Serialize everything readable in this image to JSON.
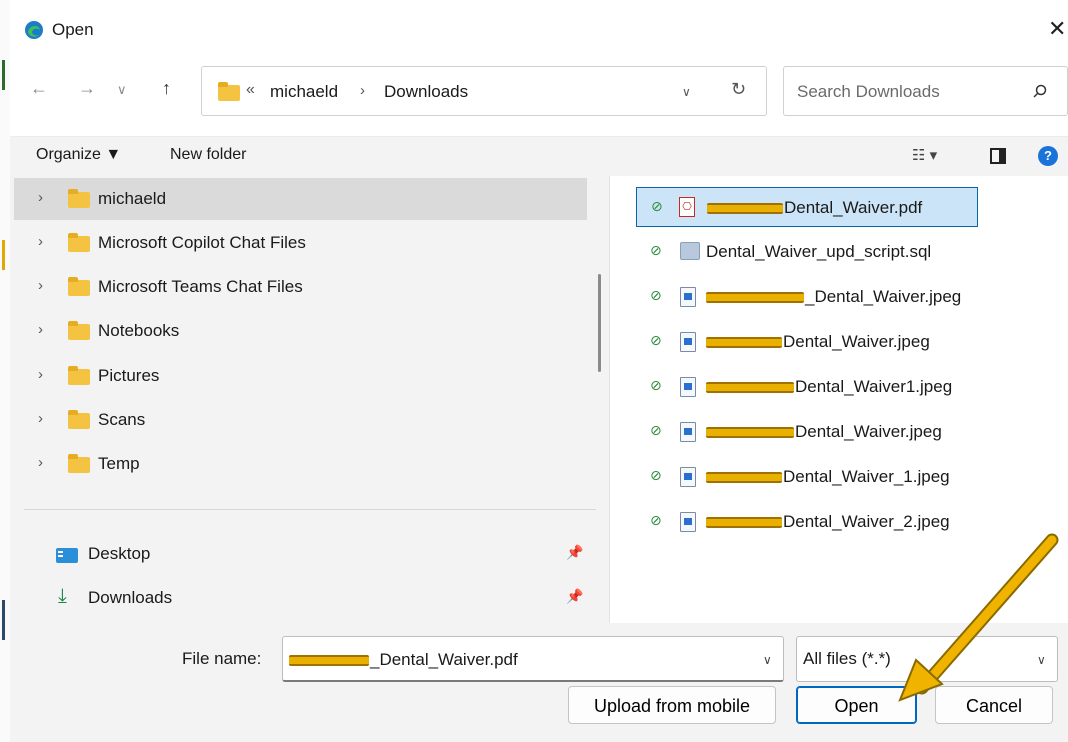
{
  "window": {
    "title": "Open"
  },
  "nav": {
    "breadcrumb_overflow": "«",
    "breadcrumb": [
      "michaeld",
      "Downloads"
    ],
    "search_placeholder": "Search Downloads"
  },
  "toolbar": {
    "organize_label": "Organize ▼",
    "new_folder_label": "New folder"
  },
  "tree": {
    "items": [
      {
        "label": "michaeld",
        "selected": true
      },
      {
        "label": "Microsoft Copilot Chat Files"
      },
      {
        "label": "Microsoft Teams Chat Files"
      },
      {
        "label": "Notebooks"
      },
      {
        "label": "Pictures"
      },
      {
        "label": "Scans"
      },
      {
        "label": "Temp"
      }
    ],
    "quick_access": [
      {
        "label": "Desktop"
      },
      {
        "label": "Downloads"
      }
    ]
  },
  "files": [
    {
      "name": "Dental_Waiver.pdf",
      "type": "pdf",
      "selected": true
    },
    {
      "name": "Dental_Waiver_upd_script.sql",
      "type": "sql"
    },
    {
      "name": "_Dental_Waiver.jpeg",
      "type": "jpeg"
    },
    {
      "name": "Dental_Waiver.jpeg",
      "type": "jpeg"
    },
    {
      "name": "Dental_Waiver1.jpeg",
      "type": "jpeg"
    },
    {
      "name": "Dental_Waiver.jpeg",
      "type": "jpeg"
    },
    {
      "name": "Dental_Waiver_1.jpeg",
      "type": "jpeg"
    },
    {
      "name": "Dental_Waiver_2.jpeg",
      "type": "jpeg"
    }
  ],
  "footer": {
    "file_name_label": "File name:",
    "file_name_value": "_Dental_Waiver.pdf",
    "file_type_value": "All files (*.*)",
    "upload_label": "Upload from mobile",
    "open_label": "Open",
    "cancel_label": "Cancel"
  },
  "colors": {
    "accent": "#0067c0",
    "selected_file_bg": "#cce4f7",
    "folder": "#f5c342",
    "annotation_arrow": "#f0b400",
    "redaction": "#e8b000"
  },
  "icons": [
    "edge-icon",
    "close-icon",
    "back-arrow-icon",
    "forward-arrow-icon",
    "up-arrow-icon",
    "folder-icon",
    "refresh-icon",
    "search-icon",
    "view-options-icon",
    "preview-pane-icon",
    "help-icon",
    "pin-icon",
    "checkmark-icon",
    "pdf-icon",
    "image-file-icon",
    "sql-file-icon"
  ]
}
